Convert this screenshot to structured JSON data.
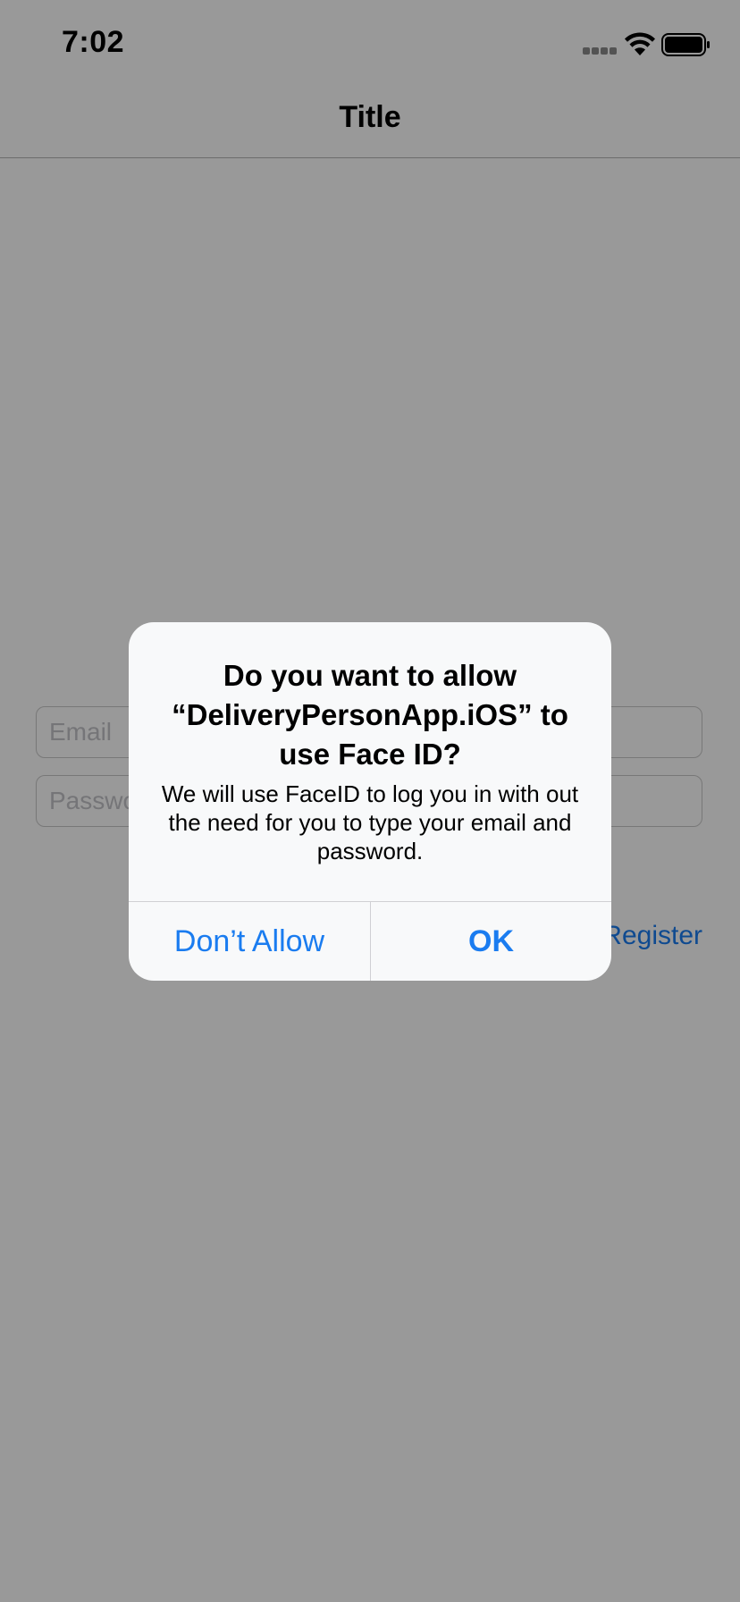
{
  "status_bar": {
    "time": "7:02",
    "icons": [
      "signal-icon",
      "wifi-icon",
      "battery-icon"
    ]
  },
  "nav": {
    "title": "Title"
  },
  "login": {
    "email_placeholder": "Email",
    "password_placeholder": "Password",
    "register_label": "Register"
  },
  "alert": {
    "title": "Do you want to allow “DeliveryPersonApp.iOS” to use Face ID?",
    "message": "We will use FaceID to log you in with out the need for you to type your email and password.",
    "dont_allow_label": "Don’t Allow",
    "ok_label": "OK"
  },
  "colors": {
    "accent": "#1a7cf0",
    "overlay": "rgba(0,0,0,0.40)",
    "alert_background": "#f8f9fa"
  }
}
